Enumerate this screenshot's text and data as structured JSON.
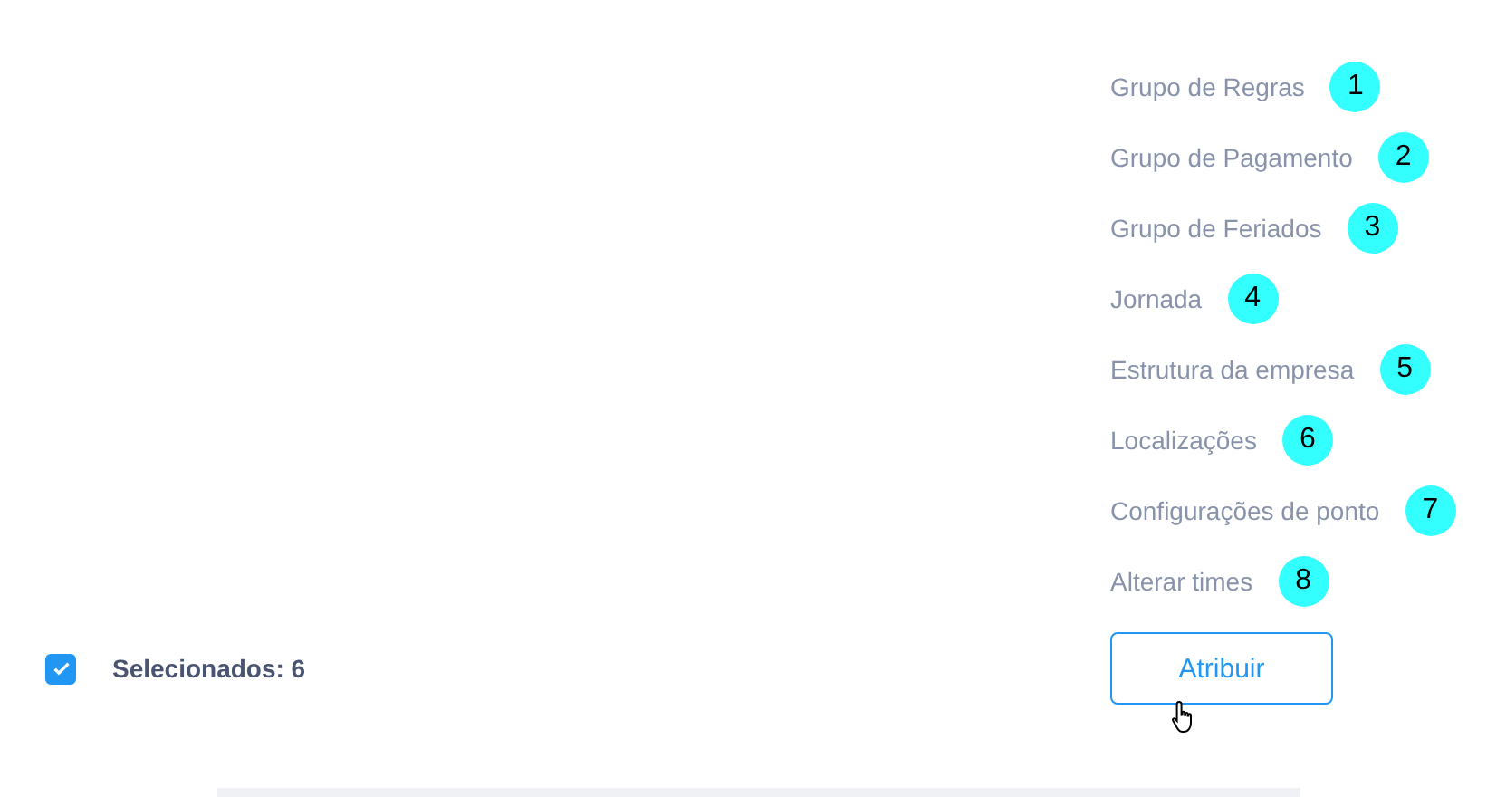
{
  "menu": {
    "items": [
      {
        "label": "Grupo de Regras",
        "badge": "1"
      },
      {
        "label": "Grupo de Pagamento",
        "badge": "2"
      },
      {
        "label": "Grupo de Feriados",
        "badge": "3"
      },
      {
        "label": "Jornada",
        "badge": "4"
      },
      {
        "label": "Estrutura da empresa",
        "badge": "5"
      },
      {
        "label": "Localizações",
        "badge": "6"
      },
      {
        "label": "Configurações de ponto",
        "badge": "7"
      },
      {
        "label": "Alterar times",
        "badge": "8"
      }
    ]
  },
  "footer": {
    "select_all": {
      "checked": true
    },
    "selected_label": "Selecionados: 6",
    "button": "Atribuir"
  }
}
